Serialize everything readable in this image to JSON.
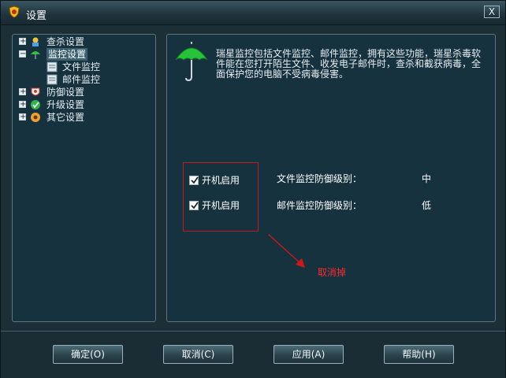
{
  "window": {
    "title": "设置",
    "close_label": "X"
  },
  "tree": {
    "items": [
      {
        "label": "查杀设置",
        "expander": "+",
        "icon": "scan-settings-icon"
      },
      {
        "label": "监控设置",
        "expander": "−",
        "icon": "umbrella-icon",
        "selected": true
      },
      {
        "label": "文件监控",
        "icon": "file-monitor-icon"
      },
      {
        "label": "邮件监控",
        "icon": "mail-monitor-icon"
      },
      {
        "label": "防御设置",
        "expander": "+",
        "icon": "defense-icon"
      },
      {
        "label": "升级设置",
        "expander": "+",
        "icon": "upgrade-icon"
      },
      {
        "label": "其它设置",
        "expander": "+",
        "icon": "other-settings-icon"
      }
    ]
  },
  "main": {
    "description": "瑞星监控包括文件监控、邮件监控，拥有这些功能，瑞星杀毒软件能在您打开陌生文件、收发电子邮件时，查杀和截获病毒，全面保护您的电脑不受病毒侵害。",
    "rows": [
      {
        "checkbox_label": "开机启用",
        "checked": true,
        "level_label": "文件监控防御级别：",
        "level_value": "中"
      },
      {
        "checkbox_label": "开机启用",
        "checked": true,
        "level_label": "邮件监控防御级别：",
        "level_value": "低"
      }
    ],
    "annotation": "取消掉",
    "colors": {
      "annotation": "#ff2a2a",
      "highlight_box": "#c21c1c"
    }
  },
  "buttons": {
    "ok": "确定(O)",
    "cancel": "取消(C)",
    "apply": "应用(A)",
    "help": "帮助(H)"
  }
}
